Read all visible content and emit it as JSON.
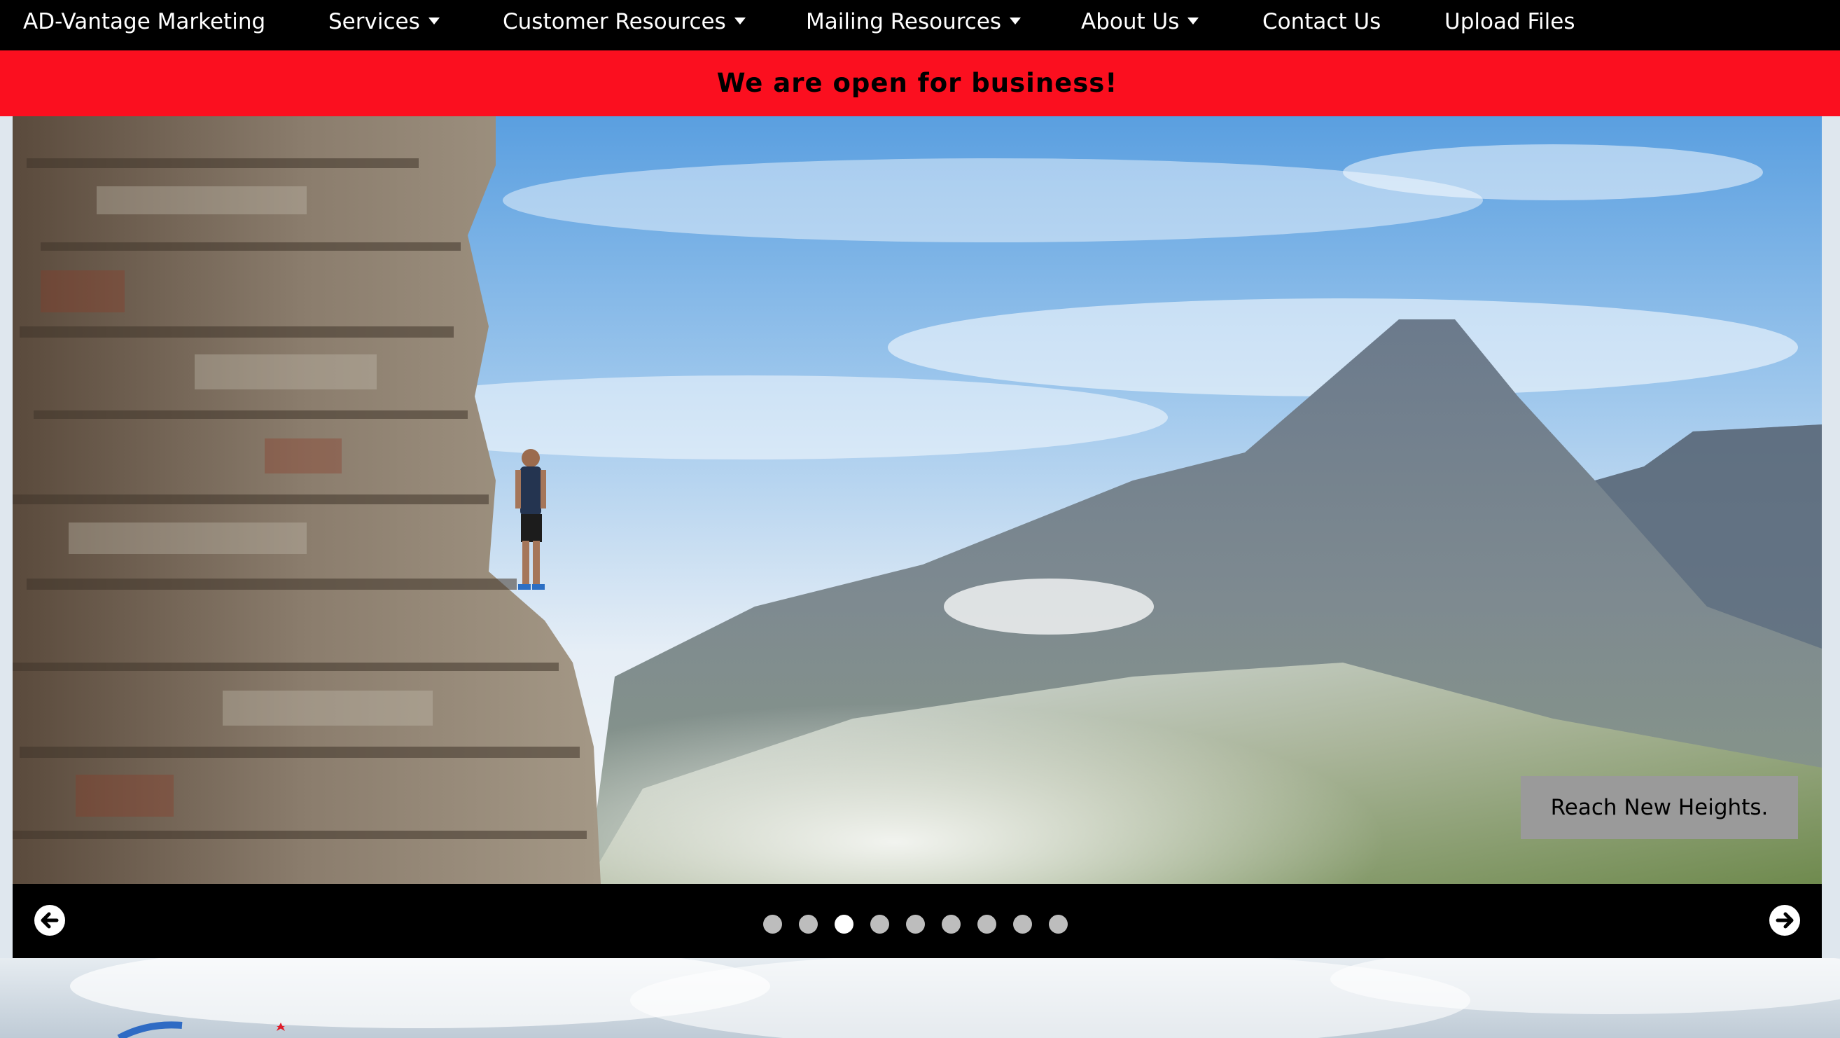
{
  "nav": {
    "brand": "AD-Vantage Marketing",
    "items": [
      {
        "label": "Services",
        "dropdown": true
      },
      {
        "label": "Customer Resources",
        "dropdown": true
      },
      {
        "label": "Mailing Resources",
        "dropdown": true
      },
      {
        "label": "About Us",
        "dropdown": true
      },
      {
        "label": "Contact Us",
        "dropdown": false
      },
      {
        "label": "Upload Files",
        "dropdown": false
      }
    ]
  },
  "banner": {
    "text": "We are open for business!",
    "color": "#fb0f1f"
  },
  "slideshow": {
    "caption": "Reach New Heights.",
    "slide_count": 9,
    "active_slide": 3,
    "prev_icon": "arrow-circle-left-icon",
    "next_icon": "arrow-circle-right-icon"
  }
}
